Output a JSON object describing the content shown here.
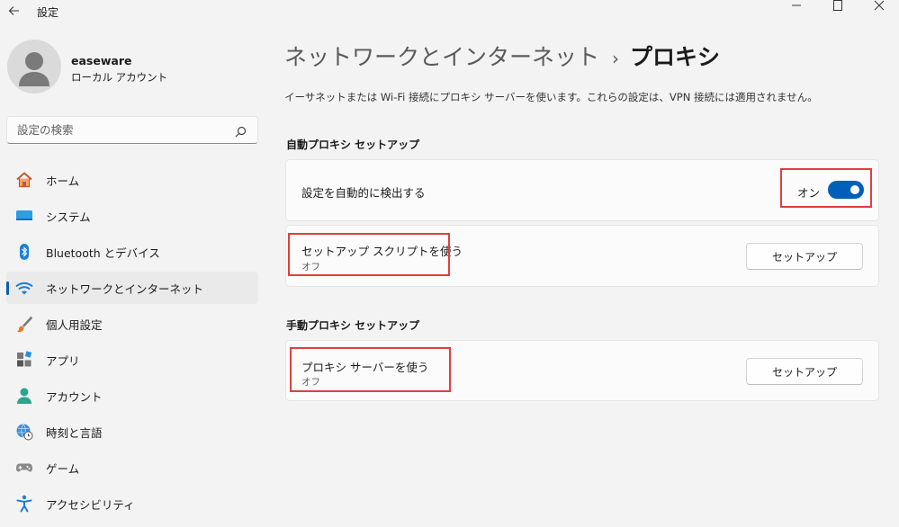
{
  "window": {
    "title": "設定"
  },
  "profile": {
    "name": "easeware",
    "account_type": "ローカル アカウント"
  },
  "search": {
    "placeholder": "設定の検索"
  },
  "nav": {
    "items": [
      {
        "label": "ホーム",
        "icon": "home-icon"
      },
      {
        "label": "システム",
        "icon": "system-icon"
      },
      {
        "label": "Bluetooth とデバイス",
        "icon": "bluetooth-icon"
      },
      {
        "label": "ネットワークとインターネット",
        "icon": "wifi-icon",
        "active": true
      },
      {
        "label": "個人用設定",
        "icon": "brush-icon"
      },
      {
        "label": "アプリ",
        "icon": "apps-icon"
      },
      {
        "label": "アカウント",
        "icon": "account-icon"
      },
      {
        "label": "時刻と言語",
        "icon": "globe-clock-icon"
      },
      {
        "label": "ゲーム",
        "icon": "gamepad-icon"
      },
      {
        "label": "アクセシビリティ",
        "icon": "accessibility-icon"
      }
    ]
  },
  "page": {
    "breadcrumb_parent": "ネットワークとインターネット",
    "breadcrumb_sep": "›",
    "title": "プロキシ",
    "description": "イーサネットまたは Wi-Fi 接続にプロキシ サーバーを使います。これらの設定は、VPN 接続には適用されません。"
  },
  "auto_proxy": {
    "section_title": "自動プロキシ セットアップ",
    "detect": {
      "label": "設定を自動的に検出する",
      "state_label": "オン",
      "enabled": true
    },
    "script": {
      "label": "セットアップ スクリプトを使う",
      "status": "オフ",
      "button": "セットアップ"
    }
  },
  "manual_proxy": {
    "section_title": "手動プロキシ セットアップ",
    "server": {
      "label": "プロキシ サーバーを使う",
      "status": "オフ",
      "button": "セットアップ"
    }
  },
  "colors": {
    "accent": "#005fb8",
    "highlight": "#e03e3e",
    "background": "#f3f3f3",
    "card": "#fbfbfb"
  }
}
